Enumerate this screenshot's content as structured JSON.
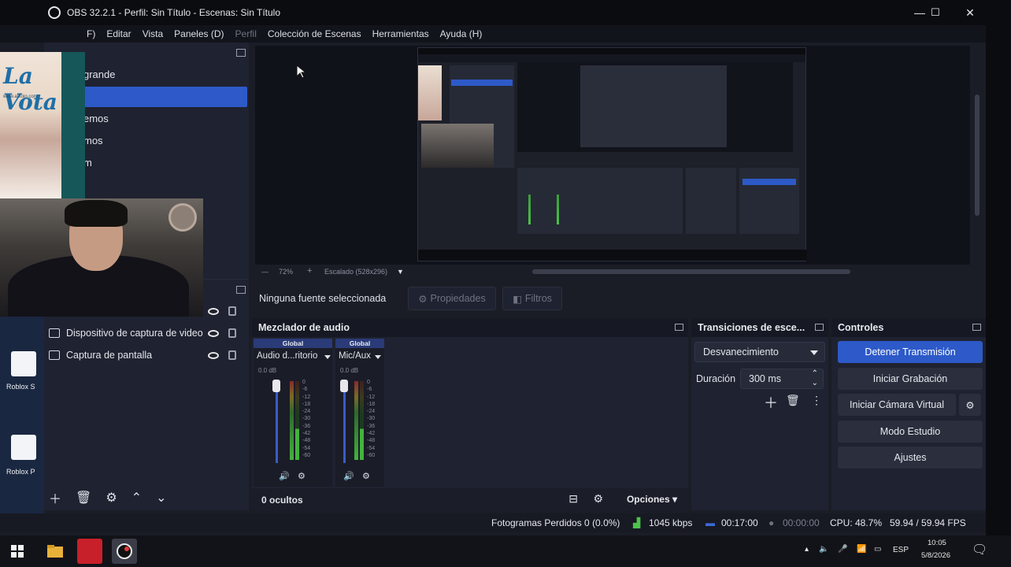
{
  "window": {
    "title": "OBS 32.2.1 - Perfil: Sin Título - Escenas: Sin Título",
    "minimize": "—",
    "maximize": "☐",
    "close": "✕"
  },
  "menu": {
    "items": [
      "F)",
      "Editar",
      "Vista",
      "Paneles (D)",
      "Perfil",
      "Colección de Escenas",
      "Herramientas",
      "Ayuda (H)"
    ]
  },
  "overlay": {
    "logo_text": "La Vota",
    "logo_sub": "www.antojo.com"
  },
  "scenes": {
    "items": [
      "grande",
      "",
      "emos",
      "mos",
      "m"
    ]
  },
  "sources": {
    "items": [
      "",
      "Dispositivo de captura de video",
      "Captura de pantalla"
    ]
  },
  "desktop": {
    "icons": [
      "Roblox S",
      "Roblox P"
    ]
  },
  "preview_toolbar": {
    "zoom": "72%",
    "scale": "Escalado (528x296)"
  },
  "source_bar": {
    "no_source": "Ninguna fuente seleccionada",
    "properties": "Propiedades",
    "filters": "Filtros"
  },
  "mixer": {
    "title": "Mezclador de audio",
    "channels": [
      {
        "global": "Global",
        "name": "Audio d...ritorio",
        "db": "0.0 dB"
      },
      {
        "global": "Global",
        "name": "Mic/Aux",
        "db": "0.0 dB"
      }
    ],
    "ticks": [
      "0",
      "-6",
      "-12",
      "-18",
      "-24",
      "-30",
      "-36",
      "-42",
      "-48",
      "-54",
      "-60"
    ],
    "hidden": "0 ocultos",
    "options": "Opciones"
  },
  "transitions": {
    "title": "Transiciones de esce...",
    "selected": "Desvanecimiento",
    "duration_label": "Duración",
    "duration_value": "300 ms"
  },
  "controls": {
    "title": "Controles",
    "buttons": [
      "Detener Transmisión",
      "Iniciar Grabación",
      "Iniciar Cámara Virtual",
      "Modo Estudio",
      "Ajustes"
    ]
  },
  "status": {
    "dropped": "Fotogramas Perdidos 0 (0.0%)",
    "bitrate": "1045 kbps",
    "stream_time": "00:17:00",
    "rec_time": "00:00:00",
    "cpu": "CPU: 48.7%",
    "fps": "59.94 / 59.94 FPS"
  },
  "taskbar": {
    "lang": "ESP",
    "time": "10:05",
    "date": "5/8/2026"
  },
  "colors": {
    "accent": "#2d5ac8",
    "panel": "#1f2230",
    "background": "#1b1d26"
  }
}
